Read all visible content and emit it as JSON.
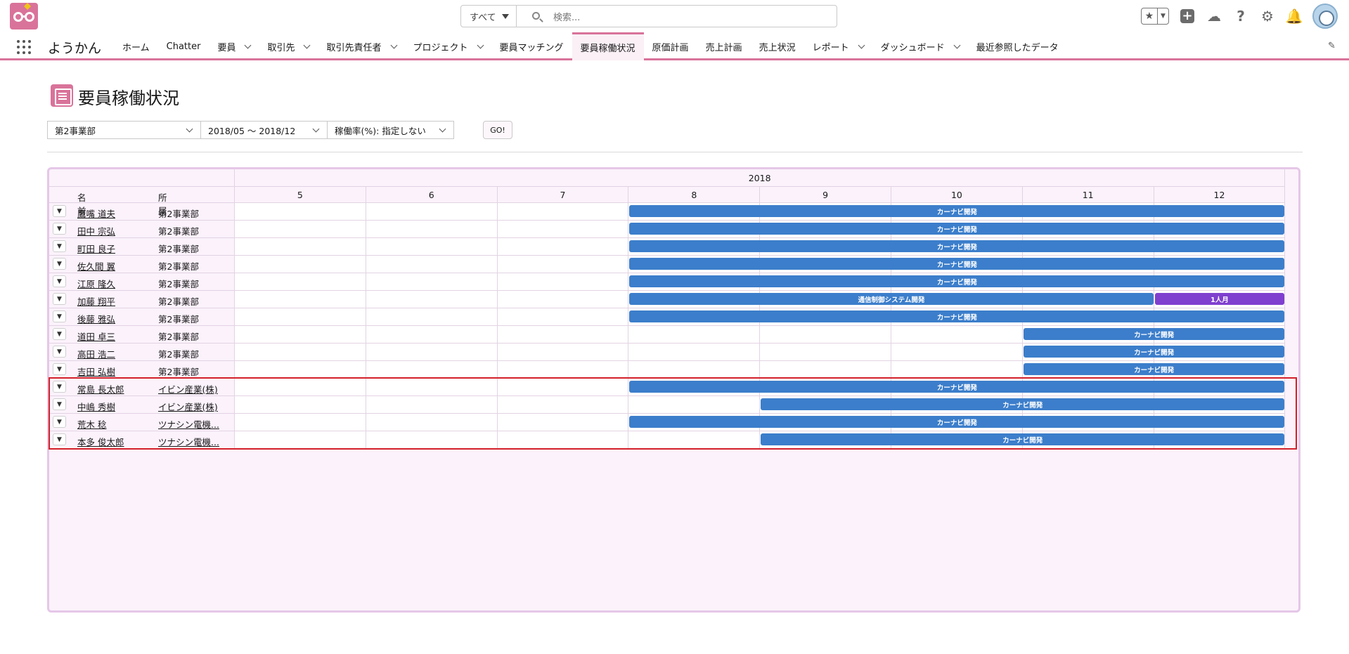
{
  "search": {
    "scope": "すべて",
    "placeholder": "検索..."
  },
  "app_name": "ようかん",
  "nav_tabs": [
    {
      "label": "ホーム",
      "chevron": false
    },
    {
      "label": "Chatter",
      "chevron": false
    },
    {
      "label": "要員",
      "chevron": true
    },
    {
      "label": "取引先",
      "chevron": true
    },
    {
      "label": "取引先責任者",
      "chevron": true
    },
    {
      "label": "プロジェクト",
      "chevron": true
    },
    {
      "label": "要員マッチング",
      "chevron": false
    },
    {
      "label": "要員稼働状況",
      "chevron": false,
      "active": true
    },
    {
      "label": "原価計画",
      "chevron": false
    },
    {
      "label": "売上計画",
      "chevron": false
    },
    {
      "label": "売上状況",
      "chevron": false
    },
    {
      "label": "レポート",
      "chevron": true
    },
    {
      "label": "ダッシュボード",
      "chevron": true
    },
    {
      "label": "最近参照したデータ",
      "chevron": false
    }
  ],
  "header_icons": [
    "star-icon",
    "plus-icon",
    "trailhead-icon",
    "help-icon",
    "gear-icon",
    "bell-icon",
    "avatar"
  ],
  "page_title": "要員稼働状況",
  "filters": {
    "department": "第2事業部",
    "period": "2018/05 ～ 2018/12",
    "utilization": "稼働率(%): 指定しない",
    "go_label": "GO!"
  },
  "grid": {
    "year": "2018",
    "col_name": "名前",
    "col_dept": "所属",
    "months": [
      "5",
      "6",
      "7",
      "8",
      "9",
      "10",
      "11",
      "12"
    ],
    "rows": [
      {
        "name": "鷹嘴 道夫",
        "dept": "第2事業部",
        "dept_link": false,
        "bars": [
          {
            "label": "カーナビ開発",
            "start": 3,
            "end": 8,
            "color": "blue"
          }
        ]
      },
      {
        "name": "田中 宗弘",
        "dept": "第2事業部",
        "dept_link": false,
        "bars": [
          {
            "label": "カーナビ開発",
            "start": 3,
            "end": 8,
            "color": "blue"
          }
        ]
      },
      {
        "name": "町田 良子",
        "dept": "第2事業部",
        "dept_link": false,
        "bars": [
          {
            "label": "カーナビ開発",
            "start": 3,
            "end": 8,
            "color": "blue"
          }
        ]
      },
      {
        "name": "佐久間 翼",
        "dept": "第2事業部",
        "dept_link": false,
        "bars": [
          {
            "label": "カーナビ開発",
            "start": 3,
            "end": 8,
            "color": "blue"
          }
        ]
      },
      {
        "name": "江原 隆久",
        "dept": "第2事業部",
        "dept_link": false,
        "bars": [
          {
            "label": "カーナビ開発",
            "start": 3,
            "end": 8,
            "color": "blue"
          }
        ]
      },
      {
        "name": "加藤 翔平",
        "dept": "第2事業部",
        "dept_link": false,
        "bars": [
          {
            "label": "通信制御システム開発",
            "start": 3,
            "end": 7,
            "color": "blue"
          },
          {
            "label": "1人月",
            "start": 7,
            "end": 8,
            "color": "purple"
          }
        ]
      },
      {
        "name": "後藤 雅弘",
        "dept": "第2事業部",
        "dept_link": false,
        "bars": [
          {
            "label": "カーナビ開発",
            "start": 3,
            "end": 8,
            "color": "blue"
          }
        ]
      },
      {
        "name": "道田 卓三",
        "dept": "第2事業部",
        "dept_link": false,
        "bars": [
          {
            "label": "カーナビ開発",
            "start": 6,
            "end": 8,
            "color": "blue"
          }
        ]
      },
      {
        "name": "高田 浩二",
        "dept": "第2事業部",
        "dept_link": false,
        "bars": [
          {
            "label": "カーナビ開発",
            "start": 6,
            "end": 8,
            "color": "blue"
          }
        ]
      },
      {
        "name": "吉田 弘樹",
        "dept": "第2事業部",
        "dept_link": false,
        "bars": [
          {
            "label": "カーナビ開発",
            "start": 6,
            "end": 8,
            "color": "blue"
          }
        ]
      },
      {
        "name": "常島 長太郎",
        "dept": "イビン産業(株)",
        "dept_link": true,
        "bars": [
          {
            "label": "カーナビ開発",
            "start": 3,
            "end": 8,
            "color": "blue"
          }
        ]
      },
      {
        "name": "中嶋 秀樹",
        "dept": "イビン産業(株)",
        "dept_link": true,
        "bars": [
          {
            "label": "カーナビ開発",
            "start": 4,
            "end": 8,
            "color": "blue"
          }
        ]
      },
      {
        "name": "荒木 稔",
        "dept": "ツナシン電機...",
        "dept_link": true,
        "bars": [
          {
            "label": "カーナビ開発",
            "start": 3,
            "end": 8,
            "color": "blue"
          }
        ]
      },
      {
        "name": "本多 俊太郎",
        "dept": "ツナシン電機...",
        "dept_link": true,
        "bars": [
          {
            "label": "カーナビ開発",
            "start": 4,
            "end": 8,
            "color": "blue"
          }
        ]
      }
    ],
    "highlight_rows": [
      10,
      13
    ]
  },
  "colors": {
    "accent": "#d9739a",
    "bar_blue": "#3c7ecb",
    "bar_purple": "#7f3fcf",
    "highlight": "#d4202a"
  }
}
